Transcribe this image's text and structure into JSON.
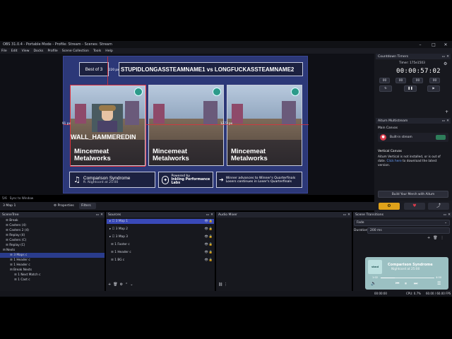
{
  "window": {
    "title": "OBS 31.0.4 - Portable Mode - Profile: Stream - Scenes: Stream"
  },
  "menu": [
    "File",
    "Edit",
    "View",
    "Docks",
    "Profile",
    "Scene Collection",
    "Tools",
    "Help"
  ],
  "scene": {
    "best_of": "Best of 3",
    "matchup": "STUPIDLONGASSTEAMNAME1 vs LONGFUCKASSTEAMNAME2",
    "player_name": "WALL_HAMMEREDIN",
    "maps": [
      {
        "line1": "Mincemeat",
        "line2": "Metalworks"
      },
      {
        "line1": "Mincemeat",
        "line2": "Metalworks"
      },
      {
        "line1": "Mincemeat",
        "line2": "Metalworks"
      }
    ],
    "song_title": "Comparison Syndrome",
    "song_sub": "ft. Nightcord at 25:00",
    "powered_line1": "Powered by",
    "powered_line2": "Inkling Performance Labs",
    "advance_line1": "Winner advances to Winner's Quarterfinals",
    "advance_line2": "Losers continues in Loser's Quarterfinals",
    "dim_left": "91 px",
    "dim_top": "220 px",
    "dim_right": "1273 px"
  },
  "countdown": {
    "header": "Countdown Timers",
    "timer_label": "Timer: 175e1503",
    "digits": "00:00:57:02",
    "labels": [
      "00",
      "00",
      "00",
      "00"
    ]
  },
  "aitum": {
    "header": "Aitum Multistream",
    "main_canvas": "Main Canvas",
    "builtin": "Built-in stream",
    "vertical_canvas": "Vertical Canvas",
    "vertical_msg": "Aitum Vertical is not installed, or is out of date.",
    "vertical_link": "Click here",
    "vertical_msg2": " to download the latest version.",
    "build_btn": "Build Your Merch with Aitum"
  },
  "toolbar": {
    "scene_name": "3 Map 1",
    "properties": "Properties",
    "filters": "Filters",
    "fps_info": "5/6",
    "sync": "Sync to Window"
  },
  "scenetree": {
    "header": "SceneTree",
    "items": [
      "Break",
      "Casters (4)",
      "Casters 2 (4)",
      "Replay (4)",
      "Casters (C)",
      "Replay (C)",
      "Nexts",
      "3 Maps c",
      "1 Header c",
      "1 Header c",
      "Break Nexts",
      "1 Next Match c",
      "1 Cast c"
    ]
  },
  "sources": {
    "header": "Sources",
    "items": [
      "3 Map 1",
      "3 Map 2",
      "3 Map 3",
      "1 Footer c",
      "1 Header c",
      "1 BG c"
    ]
  },
  "audio": {
    "header": "Audio Mixer"
  },
  "transitions": {
    "header": "Scene Transitions",
    "transition": "Fade",
    "duration_label": "Duration",
    "duration_value": "200 ms"
  },
  "player": {
    "title": "Comparison Syndrome",
    "artist": "Nightcord at 25:00",
    "logo": "vbnd",
    "elapsed": "1:02",
    "total": "4:00"
  },
  "status": {
    "time": "00:00:00",
    "cpu": "CPU: 0.7%",
    "fps": "60.00 / 60.00 FPS"
  },
  "colors": {
    "accent": "#3949b8",
    "orange": "#e0a21a",
    "red": "#d83a4a"
  }
}
